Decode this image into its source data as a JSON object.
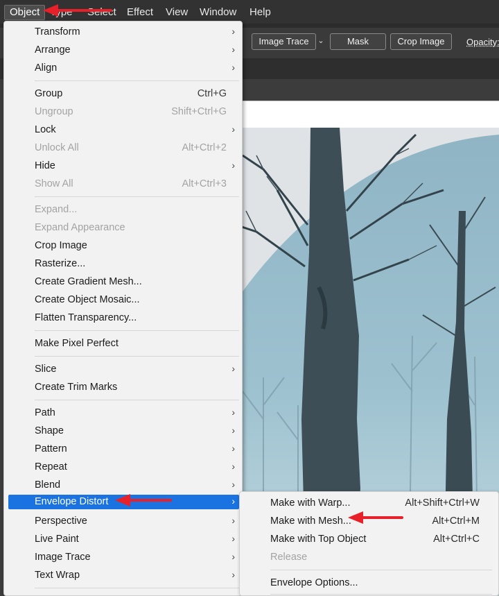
{
  "menubar": {
    "items": [
      "Object",
      "Type",
      "Select",
      "Effect",
      "View",
      "Window",
      "Help"
    ]
  },
  "controlbar": {
    "image_trace": "Image Trace",
    "mask": "Mask",
    "crop_image": "Crop Image",
    "opacity": "Opacity:"
  },
  "object_menu": {
    "items": [
      {
        "label": "Transform",
        "shortcut": "",
        "submenu": true,
        "disabled": false
      },
      {
        "label": "Arrange",
        "shortcut": "",
        "submenu": true,
        "disabled": false
      },
      {
        "label": "Align",
        "shortcut": "",
        "submenu": true,
        "disabled": false
      },
      {
        "label": "Group",
        "shortcut": "Ctrl+G",
        "submenu": false,
        "disabled": false
      },
      {
        "label": "Ungroup",
        "shortcut": "Shift+Ctrl+G",
        "submenu": false,
        "disabled": true
      },
      {
        "label": "Lock",
        "shortcut": "",
        "submenu": true,
        "disabled": false
      },
      {
        "label": "Unlock All",
        "shortcut": "Alt+Ctrl+2",
        "submenu": false,
        "disabled": true
      },
      {
        "label": "Hide",
        "shortcut": "",
        "submenu": true,
        "disabled": false
      },
      {
        "label": "Show All",
        "shortcut": "Alt+Ctrl+3",
        "submenu": false,
        "disabled": true
      },
      {
        "label": "Expand...",
        "shortcut": "",
        "submenu": false,
        "disabled": true
      },
      {
        "label": "Expand Appearance",
        "shortcut": "",
        "submenu": false,
        "disabled": true
      },
      {
        "label": "Crop Image",
        "shortcut": "",
        "submenu": false,
        "disabled": false
      },
      {
        "label": "Rasterize...",
        "shortcut": "",
        "submenu": false,
        "disabled": false
      },
      {
        "label": "Create Gradient Mesh...",
        "shortcut": "",
        "submenu": false,
        "disabled": false
      },
      {
        "label": "Create Object Mosaic...",
        "shortcut": "",
        "submenu": false,
        "disabled": false
      },
      {
        "label": "Flatten Transparency...",
        "shortcut": "",
        "submenu": false,
        "disabled": false
      },
      {
        "label": "Make Pixel Perfect",
        "shortcut": "",
        "submenu": false,
        "disabled": false
      },
      {
        "label": "Slice",
        "shortcut": "",
        "submenu": true,
        "disabled": false
      },
      {
        "label": "Create Trim Marks",
        "shortcut": "",
        "submenu": false,
        "disabled": false
      },
      {
        "label": "Path",
        "shortcut": "",
        "submenu": true,
        "disabled": false
      },
      {
        "label": "Shape",
        "shortcut": "",
        "submenu": true,
        "disabled": false
      },
      {
        "label": "Pattern",
        "shortcut": "",
        "submenu": true,
        "disabled": false
      },
      {
        "label": "Repeat",
        "shortcut": "",
        "submenu": true,
        "disabled": false
      },
      {
        "label": "Blend",
        "shortcut": "",
        "submenu": true,
        "disabled": false
      },
      {
        "label": "Envelope Distort",
        "shortcut": "",
        "submenu": true,
        "disabled": false,
        "highlighted": true
      },
      {
        "label": "Perspective",
        "shortcut": "",
        "submenu": true,
        "disabled": false
      },
      {
        "label": "Live Paint",
        "shortcut": "",
        "submenu": true,
        "disabled": false
      },
      {
        "label": "Image Trace",
        "shortcut": "",
        "submenu": true,
        "disabled": false
      },
      {
        "label": "Text Wrap",
        "shortcut": "",
        "submenu": true,
        "disabled": false
      }
    ]
  },
  "envelope_menu": {
    "items": [
      {
        "label": "Make with Warp...",
        "shortcut": "Alt+Shift+Ctrl+W",
        "disabled": false
      },
      {
        "label": "Make with Mesh...",
        "shortcut": "Alt+Ctrl+M",
        "disabled": false
      },
      {
        "label": "Make with Top Object",
        "shortcut": "Alt+Ctrl+C",
        "disabled": false
      },
      {
        "label": "Release",
        "shortcut": "",
        "disabled": true
      },
      {
        "label": "Envelope Options...",
        "shortcut": "",
        "disabled": false
      }
    ]
  },
  "colors": {
    "highlight": "#1a73e0",
    "annotation_arrow": "#e8202a"
  },
  "icons": {
    "submenu_arrow": "chevron-right-icon",
    "dropdown_caret": "chevron-down-icon"
  }
}
